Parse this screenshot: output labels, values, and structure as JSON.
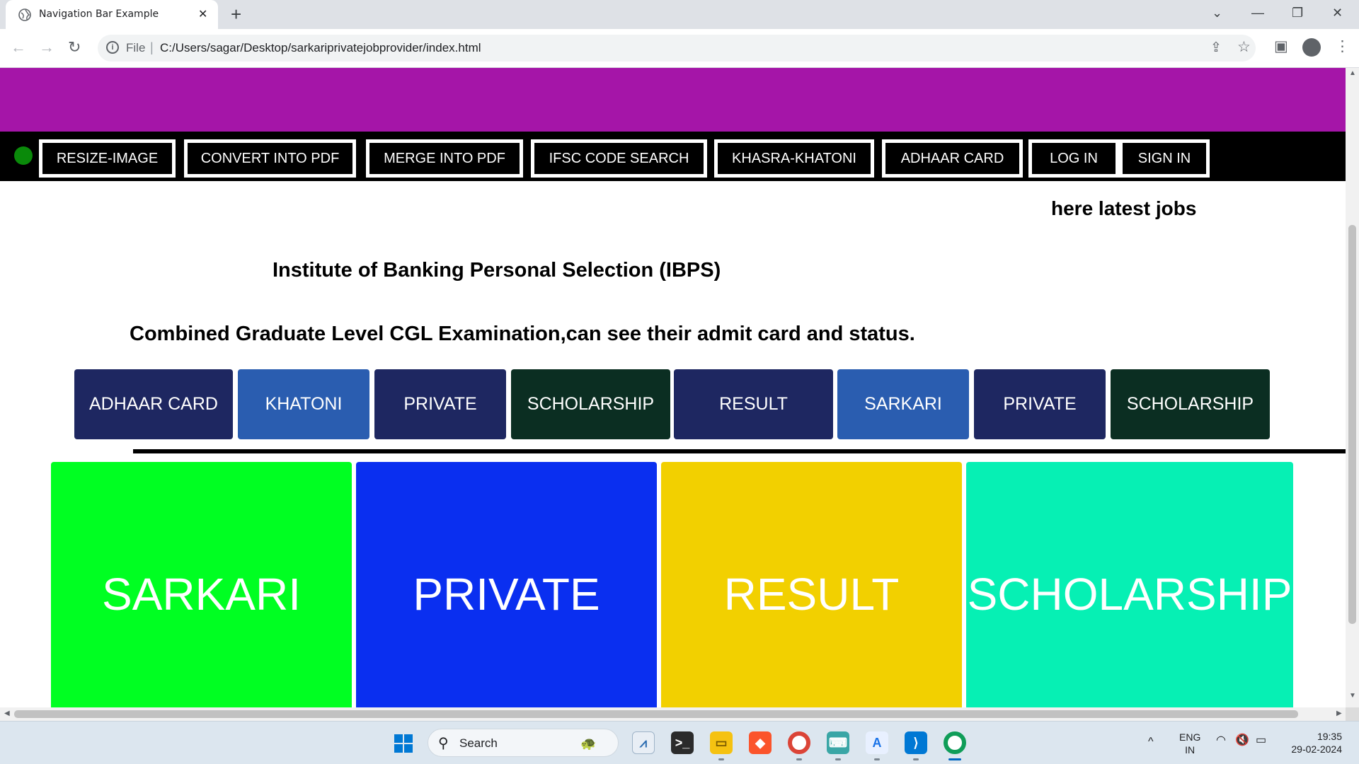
{
  "browser": {
    "tab_title": "Navigation Bar Example",
    "tab_close": "✕",
    "new_tab": "+",
    "scheme": "File",
    "url": "C:/Users/sagar/Desktop/sarkariprivatejobprovider/index.html"
  },
  "page": {
    "banner_color": "#a515a8",
    "nav_items": [
      "RESIZE-IMAGE",
      "CONVERT INTO PDF",
      "MERGE INTO PDF",
      "IFSC CODE SEARCH",
      "KHASRA-KHATONI",
      "ADHAAR CARD",
      "LOG IN",
      "SIGN IN"
    ],
    "latest_jobs": "here latest jobs",
    "heading_ibps": "Institute of Banking Personal Selection (IBPS)",
    "heading_cgl": "Combined Graduate Level CGL Examination,can see their admit card and status.",
    "categories": [
      {
        "label": "ADHAAR CARD",
        "color": "#1e2761"
      },
      {
        "label": "KHATONI",
        "color": "#2a5db0"
      },
      {
        "label": "PRIVATE",
        "color": "#1e2761"
      },
      {
        "label": "SCHOLARSHIP",
        "color": "#0b2e22"
      },
      {
        "label": "RESULT",
        "color": "#1e2761"
      },
      {
        "label": "SARKARI",
        "color": "#2a5db0"
      },
      {
        "label": "PRIVATE",
        "color": "#1e2761"
      },
      {
        "label": "SCHOLARSHIP",
        "color": "#0b2e22"
      }
    ],
    "cards": [
      {
        "label": "SARKARI",
        "color": "#00ff22"
      },
      {
        "label": "PRIVATE",
        "color": "#0a2ff0"
      },
      {
        "label": "RESULT",
        "color": "#f2d000"
      },
      {
        "label": "SCHOLARSHIP",
        "color": "#06f0b4"
      }
    ]
  },
  "taskbar": {
    "search_label": "Search",
    "lang_top": "ENG",
    "lang_bottom": "IN",
    "time": "19:35",
    "date": "29-02-2024"
  }
}
